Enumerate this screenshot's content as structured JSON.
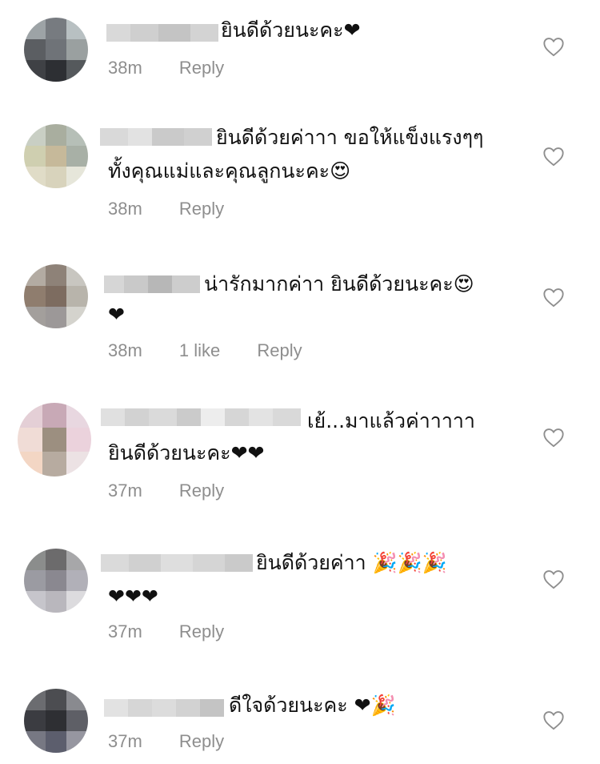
{
  "comments": [
    {
      "line1": "ยินดีด้วยนะคะ❤",
      "line2": "",
      "time": "38m",
      "likes": "",
      "reply": "Reply"
    },
    {
      "line1": "ยินดีด้วยค่าาา ขอให้แข็งแรงๆๆ",
      "line2": "ทั้งคุณแม่และคุณลูกนะคะ😍",
      "time": "38m",
      "likes": "",
      "reply": "Reply"
    },
    {
      "line1": "น่ารักมากค่าา ยินดีด้วยนะคะ😍",
      "line2": "❤",
      "time": "38m",
      "likes": "1 like",
      "reply": "Reply"
    },
    {
      "line1": "เย้...มาแล้วค่าาาาา",
      "line2": "ยินดีด้วยนะคะ❤❤",
      "time": "37m",
      "likes": "",
      "reply": "Reply"
    },
    {
      "line1": "ยินดีด้วยค่าา 🎉🎉🎉",
      "line2": "❤❤❤",
      "time": "37m",
      "likes": "",
      "reply": "Reply"
    },
    {
      "line1": "ดีใจด้วยนะคะ ❤🎉",
      "line2": "",
      "time": "37m",
      "likes": "",
      "reply": "Reply"
    }
  ],
  "icons": {
    "like": "heart-outline-icon"
  },
  "colors": {
    "meta_text": "#8e8e8e",
    "text": "#111111",
    "background": "#ffffff"
  }
}
